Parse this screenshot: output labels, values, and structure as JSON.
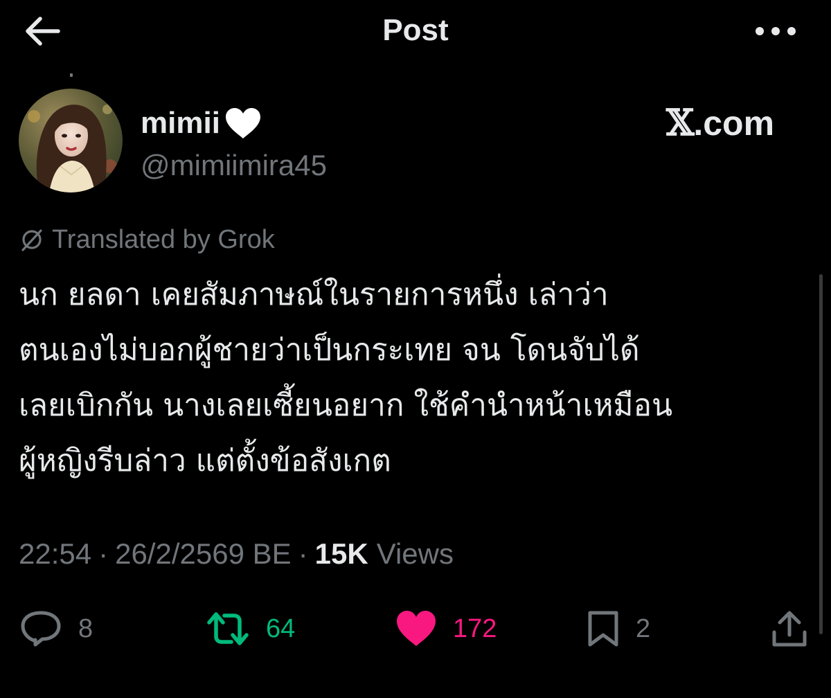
{
  "header": {
    "title": "Post",
    "back_icon": "arrow-left-icon",
    "more_icon": "more-horizontal-icon"
  },
  "author": {
    "display_name": "mimii",
    "name_emoji": "white-heart-icon",
    "handle": "@mimiimira45",
    "site_prefix": "𝕏",
    "site_domain": ".com"
  },
  "translation": {
    "label": "Translated by Grok",
    "icon": "grok-icon"
  },
  "tweet": {
    "lines": [
      "นก ยลดา เคยสัมภาษณ์ในรายการหนึ่ง เล่าว่า",
      "ตนเองไม่บอกผู้ชายว่าเป็นกระเทย จน โดนจับได้",
      "เลยเบิกกัน นางเลยเซี้ยนอยาก ใช้คำนำหน้าเหมือน",
      "ผู้หญิงรีบล่าว แต่ตั้งข้อสังเกต"
    ]
  },
  "meta": {
    "time": "22:54",
    "separator": "·",
    "date": "26/2/2569 BE",
    "views_count": "15K",
    "views_label": "Views"
  },
  "actions": {
    "replies": "8",
    "reposts": "64",
    "likes": "172",
    "bookmarks": "2"
  },
  "colors": {
    "background": "#000000",
    "text": "#e7e9ea",
    "muted": "#71767b",
    "repost": "#00ba7c",
    "like": "#f91880"
  }
}
